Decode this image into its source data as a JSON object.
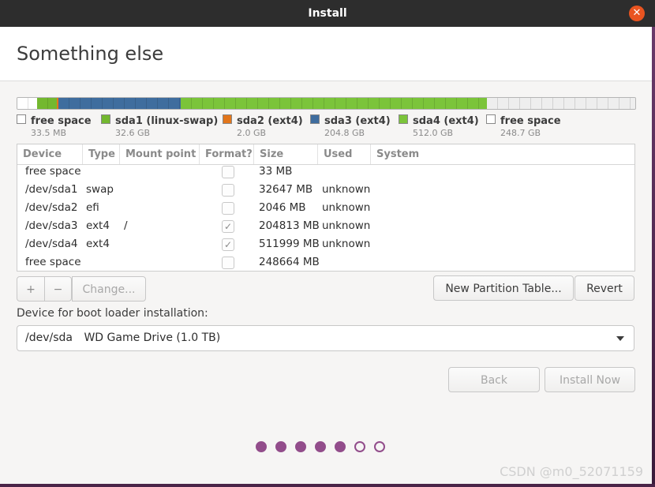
{
  "window": {
    "title": "Install",
    "close_symbol": "✕"
  },
  "page": {
    "heading": "Something else"
  },
  "partition_bar": {
    "segments": [
      {
        "name": "free space",
        "fraction": 0.0335,
        "color": "#ffffff"
      },
      {
        "name": "sda1 (linux-swap)",
        "fraction": 0.0326,
        "color": "#73b82f"
      },
      {
        "name": "sda2 (ext4)",
        "fraction": 0.002,
        "color": "#e2761b"
      },
      {
        "name": "sda3 (ext4)",
        "fraction": 0.2048,
        "color": "#3f6d9e"
      },
      {
        "name": "sda4 (ext4)",
        "fraction": 0.512,
        "color": "#7bc43a"
      },
      {
        "name": "free space",
        "fraction": 0.2487,
        "color": "#eeeeee"
      }
    ]
  },
  "legend": [
    {
      "name": "free space",
      "size": "33.5 MB",
      "color": "#ffffff"
    },
    {
      "name": "sda1 (linux-swap)",
      "size": "32.6 GB",
      "color": "#73b82f"
    },
    {
      "name": "sda2 (ext4)",
      "size": "2.0 GB",
      "color": "#e2761b"
    },
    {
      "name": "sda3 (ext4)",
      "size": "204.8 GB",
      "color": "#3f6d9e"
    },
    {
      "name": "sda4 (ext4)",
      "size": "512.0 GB",
      "color": "#7bc43a"
    },
    {
      "name": "free space",
      "size": "248.7 GB",
      "color": "#ffffff"
    }
  ],
  "table": {
    "columns": [
      "Device",
      "Type",
      "Mount point",
      "Format?",
      "Size",
      "Used",
      "System"
    ],
    "rows": [
      {
        "device": "free space",
        "type": "",
        "mount": "",
        "format": false,
        "size": "33 MB",
        "used": "",
        "system": ""
      },
      {
        "device": "/dev/sda1",
        "type": "swap",
        "mount": "",
        "format": false,
        "size": "32647 MB",
        "used": "unknown",
        "system": ""
      },
      {
        "device": "/dev/sda2",
        "type": "efi",
        "mount": "",
        "format": false,
        "size": "2046 MB",
        "used": "unknown",
        "system": ""
      },
      {
        "device": "/dev/sda3",
        "type": "ext4",
        "mount": "/",
        "format": true,
        "size": "204813 MB",
        "used": "unknown",
        "system": ""
      },
      {
        "device": "/dev/sda4",
        "type": "ext4",
        "mount": "",
        "format": true,
        "size": "511999 MB",
        "used": "unknown",
        "system": ""
      },
      {
        "device": "free space",
        "type": "",
        "mount": "",
        "format": false,
        "size": "248664 MB",
        "used": "",
        "system": ""
      }
    ]
  },
  "toolbar": {
    "add_label": "+",
    "remove_label": "−",
    "change_label": "Change...",
    "new_table_label": "New Partition Table...",
    "revert_label": "Revert"
  },
  "bootloader": {
    "label": "Device for boot loader installation:",
    "device": "/dev/sda",
    "description": "WD Game Drive (1.0 TB)"
  },
  "nav": {
    "back_label": "Back",
    "install_label": "Install Now"
  },
  "progress": {
    "total_steps": 7,
    "completed_steps": 5
  },
  "watermark": "CSDN @m0_52071159",
  "colors": {
    "accent": "#e95420",
    "progress_dot": "#924d8b",
    "titlebar": "#2d2d2d"
  }
}
